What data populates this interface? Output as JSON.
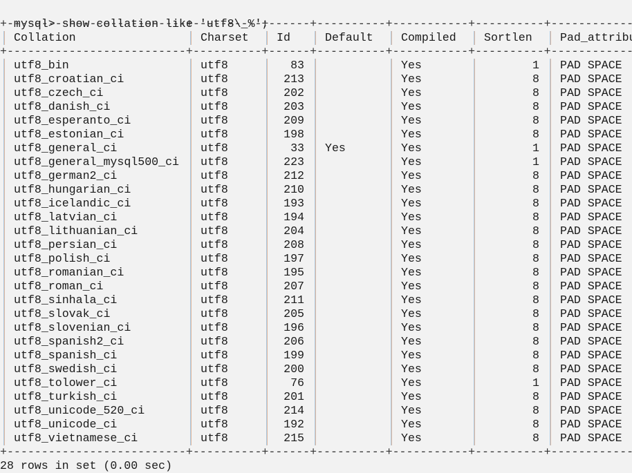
{
  "terminal": {
    "prompt": "mysql> ",
    "command": "show collation like 'utf8\\_%';",
    "footer": "28 rows in set (0.00 sec)"
  },
  "table": {
    "columns": [
      "Collation",
      "Charset",
      "Id",
      "Default",
      "Compiled",
      "Sortlen",
      "Pad_attribute"
    ],
    "rows": [
      [
        "utf8_bin",
        "utf8",
        "83",
        "",
        "Yes",
        "1",
        "PAD SPACE"
      ],
      [
        "utf8_croatian_ci",
        "utf8",
        "213",
        "",
        "Yes",
        "8",
        "PAD SPACE"
      ],
      [
        "utf8_czech_ci",
        "utf8",
        "202",
        "",
        "Yes",
        "8",
        "PAD SPACE"
      ],
      [
        "utf8_danish_ci",
        "utf8",
        "203",
        "",
        "Yes",
        "8",
        "PAD SPACE"
      ],
      [
        "utf8_esperanto_ci",
        "utf8",
        "209",
        "",
        "Yes",
        "8",
        "PAD SPACE"
      ],
      [
        "utf8_estonian_ci",
        "utf8",
        "198",
        "",
        "Yes",
        "8",
        "PAD SPACE"
      ],
      [
        "utf8_general_ci",
        "utf8",
        "33",
        "Yes",
        "Yes",
        "1",
        "PAD SPACE"
      ],
      [
        "utf8_general_mysql500_ci",
        "utf8",
        "223",
        "",
        "Yes",
        "1",
        "PAD SPACE"
      ],
      [
        "utf8_german2_ci",
        "utf8",
        "212",
        "",
        "Yes",
        "8",
        "PAD SPACE"
      ],
      [
        "utf8_hungarian_ci",
        "utf8",
        "210",
        "",
        "Yes",
        "8",
        "PAD SPACE"
      ],
      [
        "utf8_icelandic_ci",
        "utf8",
        "193",
        "",
        "Yes",
        "8",
        "PAD SPACE"
      ],
      [
        "utf8_latvian_ci",
        "utf8",
        "194",
        "",
        "Yes",
        "8",
        "PAD SPACE"
      ],
      [
        "utf8_lithuanian_ci",
        "utf8",
        "204",
        "",
        "Yes",
        "8",
        "PAD SPACE"
      ],
      [
        "utf8_persian_ci",
        "utf8",
        "208",
        "",
        "Yes",
        "8",
        "PAD SPACE"
      ],
      [
        "utf8_polish_ci",
        "utf8",
        "197",
        "",
        "Yes",
        "8",
        "PAD SPACE"
      ],
      [
        "utf8_romanian_ci",
        "utf8",
        "195",
        "",
        "Yes",
        "8",
        "PAD SPACE"
      ],
      [
        "utf8_roman_ci",
        "utf8",
        "207",
        "",
        "Yes",
        "8",
        "PAD SPACE"
      ],
      [
        "utf8_sinhala_ci",
        "utf8",
        "211",
        "",
        "Yes",
        "8",
        "PAD SPACE"
      ],
      [
        "utf8_slovak_ci",
        "utf8",
        "205",
        "",
        "Yes",
        "8",
        "PAD SPACE"
      ],
      [
        "utf8_slovenian_ci",
        "utf8",
        "196",
        "",
        "Yes",
        "8",
        "PAD SPACE"
      ],
      [
        "utf8_spanish2_ci",
        "utf8",
        "206",
        "",
        "Yes",
        "8",
        "PAD SPACE"
      ],
      [
        "utf8_spanish_ci",
        "utf8",
        "199",
        "",
        "Yes",
        "8",
        "PAD SPACE"
      ],
      [
        "utf8_swedish_ci",
        "utf8",
        "200",
        "",
        "Yes",
        "8",
        "PAD SPACE"
      ],
      [
        "utf8_tolower_ci",
        "utf8",
        "76",
        "",
        "Yes",
        "1",
        "PAD SPACE"
      ],
      [
        "utf8_turkish_ci",
        "utf8",
        "201",
        "",
        "Yes",
        "8",
        "PAD SPACE"
      ],
      [
        "utf8_unicode_520_ci",
        "utf8",
        "214",
        "",
        "Yes",
        "8",
        "PAD SPACE"
      ],
      [
        "utf8_unicode_ci",
        "utf8",
        "192",
        "",
        "Yes",
        "8",
        "PAD SPACE"
      ],
      [
        "utf8_vietnamese_ci",
        "utf8",
        "215",
        "",
        "Yes",
        "8",
        "PAD SPACE"
      ]
    ]
  }
}
